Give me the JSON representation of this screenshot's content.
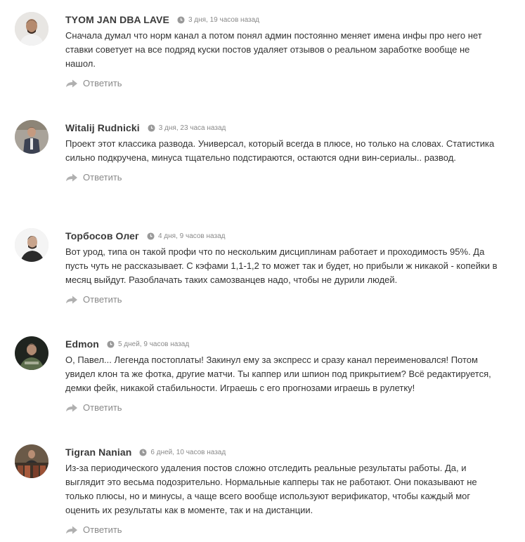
{
  "comments": [
    {
      "author": "TYOM JAN DBA LAVE",
      "time": "3 дня, 19 часов назад",
      "text": "Сначала думал что норм канал а потом понял админ постоянно меняет имена инфы про него нет ставки советует на все подряд куски постов удаляет отзывов о реальном заработке вообще не нашол.",
      "reply_label": "Ответить"
    },
    {
      "author": "Witalij Rudnicki",
      "time": "3 дня, 23 часа назад",
      "text": "Проект этот классика развода. Универсал, который всегда в плюсе, но только на словах. Статистика сильно подкручена, минуса тщательно подстираются, остаются одни вин-сериалы.. развод.",
      "reply_label": "Ответить"
    },
    {
      "author": "Торбосов Олег",
      "time": "4 дня, 9 часов назад",
      "text": "Вот урод, типа он такой профи что по нескольким дисциплинам работает и проходимость 95%. Да пусть чуть не рассказывает. С кэфами 1,1-1,2 то может так и будет, но прибыли ж никакой - копейки в месяц выйдут. Разоблачать таких самозванцев надо, чтобы не дурили людей.",
      "reply_label": "Ответить"
    },
    {
      "author": "Edmon",
      "time": "5 дней, 9 часов назад",
      "text": "О, Павел... Легенда постоплаты! Закинул ему за экспресс и сразу канал переименовался! Потом увидел клон та же фотка, другие матчи. Ты каппер или шпион под прикрытием? Всё редактируется, демки фейк, никакой стабильности. Играешь с его прогнозами играешь в рулетку!",
      "reply_label": "Ответить"
    },
    {
      "author": "Tigran Nanian",
      "time": "6 дней, 10 часов назад",
      "text": "Из-за периодического удаления постов сложно отследить реальные результаты работы. Да, и выглядит это весьма подозрительно. Нормальные капперы так не работают. Они показывают не только плюсы, но и минусы, а чаще всего вообще используют верификатор, чтобы каждый мог оценить их результаты как в моменте, так и на дистанции.",
      "reply_label": "Ответить"
    }
  ]
}
